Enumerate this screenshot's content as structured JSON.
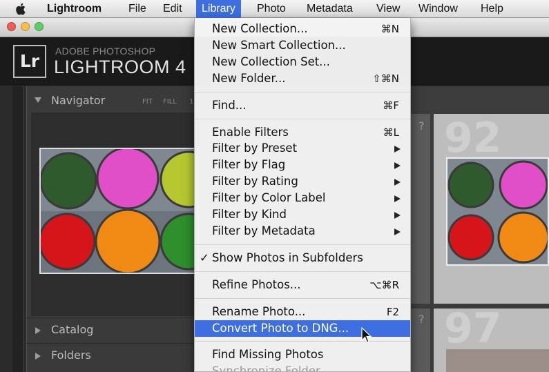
{
  "menubar": {
    "items": [
      {
        "label": "Lightroom",
        "bold": true
      },
      {
        "label": "File"
      },
      {
        "label": "Edit"
      },
      {
        "label": "Library",
        "active": true
      },
      {
        "label": "Photo"
      },
      {
        "label": "Metadata"
      },
      {
        "label": "View"
      },
      {
        "label": "Window"
      },
      {
        "label": "Help"
      }
    ]
  },
  "window": {
    "traffic_lights": [
      "#ec5d57",
      "#f5bf4f",
      "#5fcf65"
    ]
  },
  "identity": {
    "badge": "Lr",
    "line1": "ADOBE PHOTOSHOP",
    "line2": "LIGHTROOM 4"
  },
  "navigator": {
    "title": "Navigator",
    "zoom_options": [
      "FIT",
      "FILL",
      "1"
    ]
  },
  "panels": [
    {
      "label": "Catalog"
    },
    {
      "label": "Folders"
    }
  ],
  "grid": {
    "cell_numbers": [
      "92",
      "97"
    ],
    "badge_glyph": "?"
  },
  "library_menu": {
    "items": [
      {
        "label": "New Collection...",
        "shortcut": "⌘N"
      },
      {
        "label": "New Smart Collection..."
      },
      {
        "label": "New Collection Set..."
      },
      {
        "label": "New Folder...",
        "shortcut": "⇧⌘N"
      },
      {
        "separator": true
      },
      {
        "label": "Find...",
        "shortcut": "⌘F"
      },
      {
        "separator": true
      },
      {
        "label": "Enable Filters",
        "shortcut": "⌘L"
      },
      {
        "label": "Filter by Preset",
        "submenu": true
      },
      {
        "label": "Filter by Flag",
        "submenu": true
      },
      {
        "label": "Filter by Rating",
        "submenu": true
      },
      {
        "label": "Filter by Color Label",
        "submenu": true
      },
      {
        "label": "Filter by Kind",
        "submenu": true
      },
      {
        "label": "Filter by Metadata",
        "submenu": true
      },
      {
        "separator": true
      },
      {
        "label": "Show Photos in Subfolders",
        "checked": true
      },
      {
        "separator": true
      },
      {
        "label": "Refine Photos...",
        "shortcut": "⌥⌘R"
      },
      {
        "separator": true
      },
      {
        "label": "Rename Photo...",
        "shortcut": "F2"
      },
      {
        "label": "Convert Photo to DNG...",
        "highlighted": true
      },
      {
        "separator": true
      },
      {
        "label": "Find Missing Photos"
      },
      {
        "label": "Synchronize Folder",
        "dimmed": true
      }
    ]
  },
  "photo": {
    "colors": [
      "#2f5a2e",
      "#e04fc8",
      "#b7c730",
      "#d8141b",
      "#f08a15",
      "#2e8f2c"
    ]
  }
}
